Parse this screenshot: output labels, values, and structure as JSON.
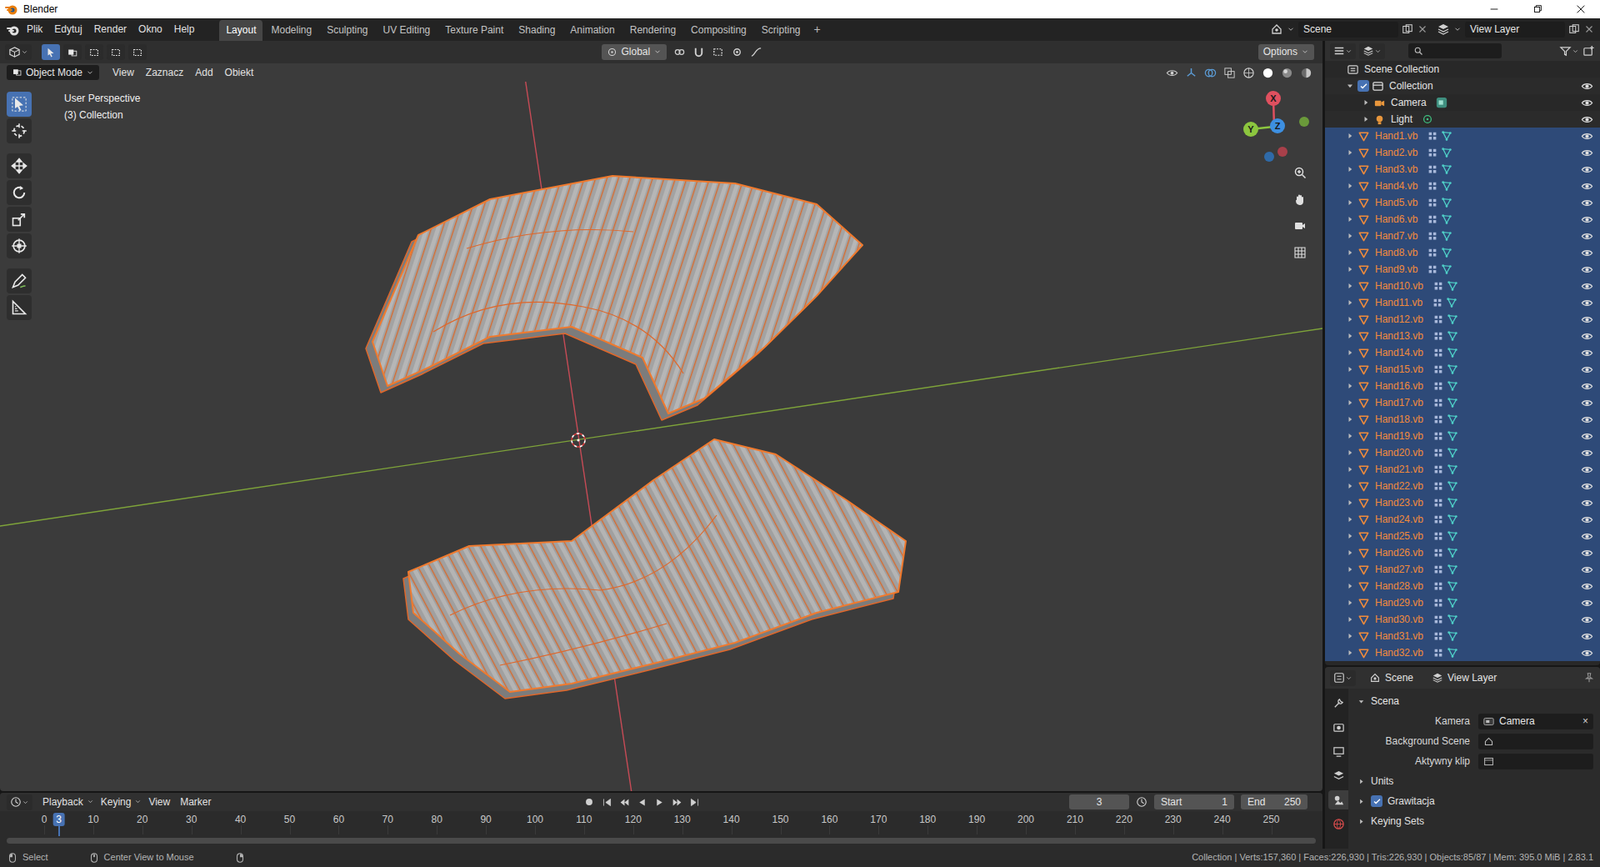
{
  "window": {
    "title": "Blender"
  },
  "topbar": {
    "menus": [
      "Plik",
      "Edytuj",
      "Render",
      "Okno",
      "Help"
    ],
    "workspaces": [
      {
        "label": "Layout",
        "selected": true
      },
      {
        "label": "Modeling",
        "selected": false
      },
      {
        "label": "Sculpting",
        "selected": false
      },
      {
        "label": "UV Editing",
        "selected": false
      },
      {
        "label": "Texture Paint",
        "selected": false
      },
      {
        "label": "Shading",
        "selected": false
      },
      {
        "label": "Animation",
        "selected": false
      },
      {
        "label": "Rendering",
        "selected": false
      },
      {
        "label": "Compositing",
        "selected": false
      },
      {
        "label": "Scripting",
        "selected": false
      }
    ],
    "add_workspace": "+",
    "scene": "Scene",
    "view_layer": "View Layer"
  },
  "tool_header": {
    "select_modes": [
      {
        "selected": true
      },
      {
        "selected": false
      },
      {
        "selected": false
      },
      {
        "selected": false
      },
      {
        "selected": false
      }
    ],
    "orientation": "Global",
    "options": "Options"
  },
  "viewport_header": {
    "mode": "Object Mode",
    "menus": [
      "View",
      "Zaznacz",
      "Add",
      "Obiekt"
    ]
  },
  "toolbar": [
    {
      "kind": "select",
      "selected": true
    },
    {
      "kind": "cursor",
      "selected": false
    },
    {
      "kind": "move",
      "selected": false
    },
    {
      "kind": "rotate",
      "selected": false
    },
    {
      "kind": "scale",
      "selected": false
    },
    {
      "kind": "transform",
      "selected": false
    },
    {
      "kind": "annotate",
      "selected": false
    },
    {
      "kind": "measure",
      "selected": false
    }
  ],
  "overlay": {
    "view": "User Perspective",
    "collection": "(3) Collection"
  },
  "gizmo": {
    "axes": [
      {
        "label": "X",
        "color": "#e0505f"
      },
      {
        "label": "Y",
        "color": "#8cc63f"
      },
      {
        "label": "Z",
        "color": "#3d8fe0"
      }
    ]
  },
  "timeline": {
    "menus": [
      "Playback",
      "Keying",
      "View",
      "Marker"
    ],
    "frame": "3",
    "start_label": "Start",
    "start": "1",
    "end_label": "End",
    "end": "250",
    "ticks": [
      "0",
      "10",
      "20",
      "30",
      "40",
      "50",
      "60",
      "70",
      "80",
      "90",
      "100",
      "110",
      "120",
      "130",
      "140",
      "150",
      "160",
      "170",
      "180",
      "190",
      "200",
      "210",
      "220",
      "230",
      "240",
      "250"
    ],
    "cursor": "3"
  },
  "outliner": {
    "root": "Scene Collection",
    "items": [
      {
        "name": "Collection",
        "kind": "collection",
        "selected": false,
        "expanded": true,
        "checked": true,
        "visible": true
      },
      {
        "name": "Camera",
        "kind": "camera",
        "selected": false,
        "expanded": false,
        "visible": true
      },
      {
        "name": "Light",
        "kind": "light",
        "selected": false,
        "expanded": false,
        "visible": true
      },
      {
        "name": "Hand1.vb",
        "kind": "mesh",
        "selected": true,
        "expanded": false,
        "visible": true
      },
      {
        "name": "Hand2.vb",
        "kind": "mesh",
        "selected": true,
        "expanded": false,
        "visible": true
      },
      {
        "name": "Hand3.vb",
        "kind": "mesh",
        "selected": true,
        "expanded": false,
        "visible": true
      },
      {
        "name": "Hand4.vb",
        "kind": "mesh",
        "selected": true,
        "expanded": false,
        "visible": true
      },
      {
        "name": "Hand5.vb",
        "kind": "mesh",
        "selected": true,
        "expanded": false,
        "visible": true
      },
      {
        "name": "Hand6.vb",
        "kind": "mesh",
        "selected": true,
        "expanded": false,
        "visible": true
      },
      {
        "name": "Hand7.vb",
        "kind": "mesh",
        "selected": true,
        "expanded": false,
        "visible": true
      },
      {
        "name": "Hand8.vb",
        "kind": "mesh",
        "selected": true,
        "expanded": false,
        "visible": true
      },
      {
        "name": "Hand9.vb",
        "kind": "mesh",
        "selected": true,
        "expanded": false,
        "visible": true
      },
      {
        "name": "Hand10.vb",
        "kind": "mesh",
        "selected": true,
        "expanded": false,
        "visible": true
      },
      {
        "name": "Hand11.vb",
        "kind": "mesh",
        "selected": true,
        "expanded": false,
        "visible": true
      },
      {
        "name": "Hand12.vb",
        "kind": "mesh",
        "selected": true,
        "expanded": false,
        "visible": true
      },
      {
        "name": "Hand13.vb",
        "kind": "mesh",
        "selected": true,
        "expanded": false,
        "visible": true
      },
      {
        "name": "Hand14.vb",
        "kind": "mesh",
        "selected": true,
        "expanded": false,
        "visible": true
      },
      {
        "name": "Hand15.vb",
        "kind": "mesh",
        "selected": true,
        "expanded": false,
        "visible": true
      },
      {
        "name": "Hand16.vb",
        "kind": "mesh",
        "selected": true,
        "expanded": false,
        "visible": true
      },
      {
        "name": "Hand17.vb",
        "kind": "mesh",
        "selected": true,
        "expanded": false,
        "visible": true
      },
      {
        "name": "Hand18.vb",
        "kind": "mesh",
        "selected": true,
        "expanded": false,
        "visible": true
      },
      {
        "name": "Hand19.vb",
        "kind": "mesh",
        "selected": true,
        "expanded": false,
        "visible": true
      },
      {
        "name": "Hand20.vb",
        "kind": "mesh",
        "selected": true,
        "expanded": false,
        "visible": true
      },
      {
        "name": "Hand21.vb",
        "kind": "mesh",
        "selected": true,
        "expanded": false,
        "visible": true
      },
      {
        "name": "Hand22.vb",
        "kind": "mesh",
        "selected": true,
        "expanded": false,
        "visible": true
      },
      {
        "name": "Hand23.vb",
        "kind": "mesh",
        "selected": true,
        "expanded": false,
        "visible": true
      },
      {
        "name": "Hand24.vb",
        "kind": "mesh",
        "selected": true,
        "expanded": false,
        "visible": true
      },
      {
        "name": "Hand25.vb",
        "kind": "mesh",
        "selected": true,
        "expanded": false,
        "visible": true
      },
      {
        "name": "Hand26.vb",
        "kind": "mesh",
        "selected": true,
        "expanded": false,
        "visible": true
      },
      {
        "name": "Hand27.vb",
        "kind": "mesh",
        "selected": true,
        "expanded": false,
        "visible": true
      },
      {
        "name": "Hand28.vb",
        "kind": "mesh",
        "selected": true,
        "expanded": false,
        "visible": true
      },
      {
        "name": "Hand29.vb",
        "kind": "mesh",
        "selected": true,
        "expanded": false,
        "visible": true
      },
      {
        "name": "Hand30.vb",
        "kind": "mesh",
        "selected": true,
        "expanded": false,
        "visible": true
      },
      {
        "name": "Hand31.vb",
        "kind": "mesh",
        "selected": true,
        "expanded": false,
        "visible": true
      },
      {
        "name": "Hand32.vb",
        "kind": "mesh",
        "selected": true,
        "expanded": false,
        "visible": true
      }
    ]
  },
  "properties": {
    "editor_tabs": [
      {
        "kind": "tool",
        "selected": false
      },
      {
        "kind": "render",
        "selected": false
      },
      {
        "kind": "output",
        "selected": false
      },
      {
        "kind": "viewlayer",
        "selected": false
      },
      {
        "kind": "scene",
        "selected": true
      },
      {
        "kind": "world",
        "selected": false
      }
    ],
    "tabs": [
      {
        "label": "Scene"
      },
      {
        "label": "View Layer"
      }
    ],
    "panel": "Scena",
    "fields": [
      {
        "label": "Kamera",
        "value": "Camera",
        "clear": "×"
      },
      {
        "label": "Background Scene"
      },
      {
        "label": "Aktywny klip"
      }
    ],
    "subpanels": [
      {
        "label": "Units",
        "kind": "plain"
      },
      {
        "label": "Grawitacja",
        "kind": "checkbox",
        "checked": true
      },
      {
        "label": "Keying Sets",
        "kind": "plain"
      }
    ]
  },
  "status_bar": {
    "hints": [
      "Select",
      "Center View to Mouse"
    ],
    "stats": "Collection | Verts:157,360 | Faces:226,930 | Tris:226,930 | Objects:85/87 | Mem: 395.0 MiB | 2.83.1"
  }
}
